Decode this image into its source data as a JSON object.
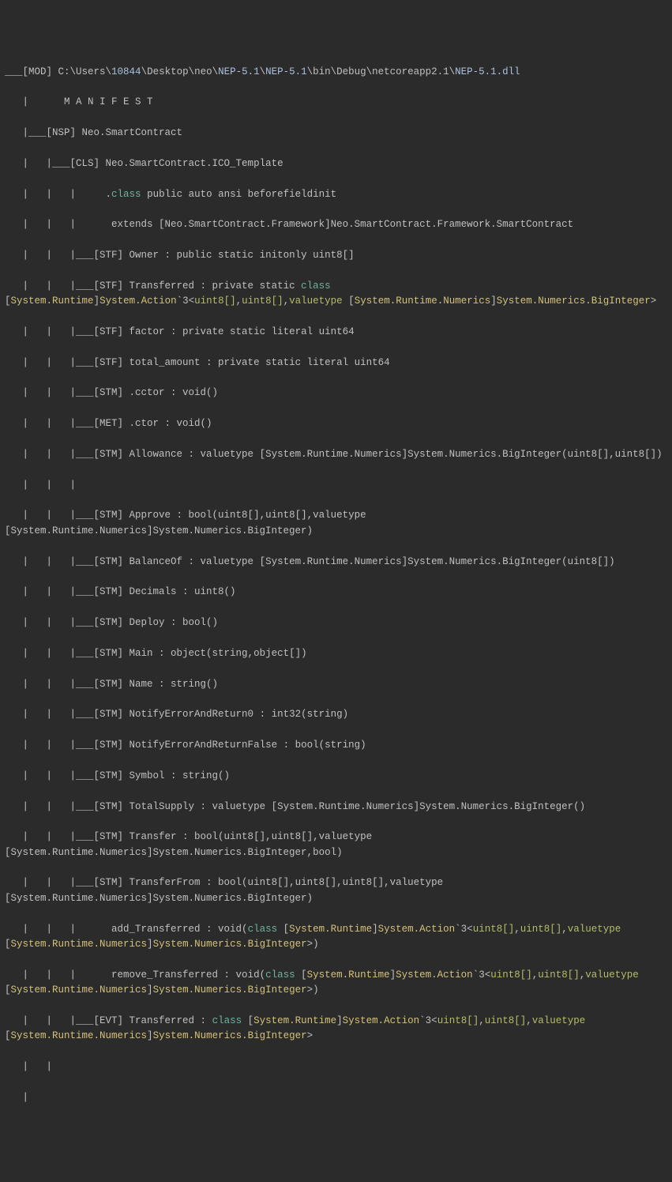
{
  "header": {
    "mod_tag": "___[MOD] ",
    "path_pre": "C:",
    "path_users": "\\Users\\",
    "path_user": "10844",
    "path_desk": "\\Desktop\\neo\\",
    "path_nep1": "NEP-5.1",
    "path_sep": "\\",
    "path_nep2": "NEP-5.1",
    "path_bin": "\\bin\\Debug\\netcoreapp2.1\\",
    "path_dll": "NEP-5.1.dll"
  },
  "lines": {
    "l2": "   |      M A N I F E S T",
    "l3": "   |___[NSP] Neo.SmartContract",
    "l4": "   |   |___[CLS] Neo.SmartContract.ICO_Template",
    "l5a": "   |   |   |     .",
    "l5kw": "class",
    "l5b": " public auto ansi beforefieldinit ",
    "l6": "   |   |   |      extends [Neo.SmartContract.Framework]Neo.SmartContract.Framework.SmartContract",
    "l7": "   |   |   |___[STF] Owner : public static initonly uint8[]",
    "l8a": "   |   |   |___[STF] Transferred : private static ",
    "l8kw": "class",
    "l8b1": " [",
    "l8y1": "System.Runtime",
    "l8b2": "]",
    "l8y2": "System.Action",
    "l8b3": "`3<",
    "l8o1": "uint8[]",
    "l8c1": ",",
    "l8o2": "uint8[]",
    "l8c2": ",",
    "l8o3": "valuetype",
    "l9a": " [",
    "l9y1": "System.Runtime.Numerics",
    "l9b1": "]",
    "l9y2": "System.Numerics.BigInteger",
    "l9b2": ">",
    "l10": "   |   |   |___[STF] factor : private static literal uint64",
    "l11": "   |   |   |___[STF] total_amount : private static literal uint64",
    "l12": "   |   |   |___[STM] .cctor : void()",
    "l13": "   |   |   |___[MET] .ctor : void()",
    "l14": "   |   |   |___[STM] Allowance : valuetype [System.Runtime.Numerics]System.Numerics.BigInteger(uint8[],uint8[])",
    "l14cont": "   |   |   |",
    "l15": "   |   |   |___[STM] Approve : bool(uint8[],uint8[],valuetype [System.Runtime.Numerics]System.Numerics.BigInteger)",
    "l16": "   |   |   |___[STM] BalanceOf : valuetype [System.Runtime.Numerics]System.Numerics.BigInteger(uint8[])",
    "l17": "   |   |   |___[STM] Decimals : uint8()",
    "l18": "   |   |   |___[STM] Deploy : bool()",
    "l19": "   |   |   |___[STM] Main : object(string,object[])",
    "l20": "   |   |   |___[STM] Name : string()",
    "l21": "   |   |   |___[STM] NotifyErrorAndReturn0 : int32(string)",
    "l22": "   |   |   |___[STM] NotifyErrorAndReturnFalse : bool(string)",
    "l23": "   |   |   |___[STM] Symbol : string()",
    "l24": "   |   |   |___[STM] TotalSupply : valuetype [System.Runtime.Numerics]System.Numerics.BigInteger()",
    "l25": "   |   |   |___[STM] Transfer : bool(uint8[],uint8[],valuetype [System.Runtime.Numerics]System.Numerics.BigInteger,bool)",
    "l26": "   |   |   |___[STM] TransferFrom : bool(uint8[],uint8[],uint8[],valuetype [System.Runtime.Numerics]System.Numerics.BigInteger)",
    "l27a": "   |   |   |      add_Transferred : void(",
    "l27kw": "class",
    "l27b1": " [",
    "l27y1": "System.Runtime",
    "l27b2": "]",
    "l27y2": "System.Action",
    "l27b3": "`3<",
    "l27o1": "uint8[]",
    "l27c1": ",",
    "l27o2": "uint8[]",
    "l27c2": ",",
    "l27o3": "valuetype",
    "l27tail1": " [",
    "l27y3": "System.Runtime.Numerics",
    "l27tail2": "]",
    "l27y4": "System.Numerics.BigInteger",
    "l27tail3": ">)",
    "l28a": "   |   |   |      remove_Transferred : void(",
    "l28kw": "class",
    "l28b1": " [",
    "l28y1": "System.Runtime",
    "l28b2": "]",
    "l28y2": "System.Action",
    "l28b3": "`3<",
    "l28o1": "uint8[]",
    "l28c1": ",",
    "l28o2": "uint8[]",
    "l28c2": ",",
    "l28o3": "valuetype",
    "l28tail1": " [",
    "l28y3": "System.Runtime.Numerics",
    "l28tail2": "]",
    "l28y4": "System.Numerics.BigInteger",
    "l28tail3": ">)",
    "l29a": "   |   |   |___[EVT] Transferred : ",
    "l29kw": "class",
    "l29b1": " [",
    "l29y1": "System.Runtime",
    "l29b2": "]",
    "l29y2": "System.Action",
    "l29b3": "`3<",
    "l29o1": "uint8[]",
    "l29c1": ",",
    "l29o2": "uint8[]",
    "l29c2": ",",
    "l29o3": "valuetype",
    "l29tail1": " [",
    "l29y3": "System.Runtime.Numerics",
    "l29tail2": "]",
    "l29y4": "System.Numerics.BigInteger",
    "l29tail3": ">",
    "l30": "   |   |",
    "l31": "   |"
  }
}
